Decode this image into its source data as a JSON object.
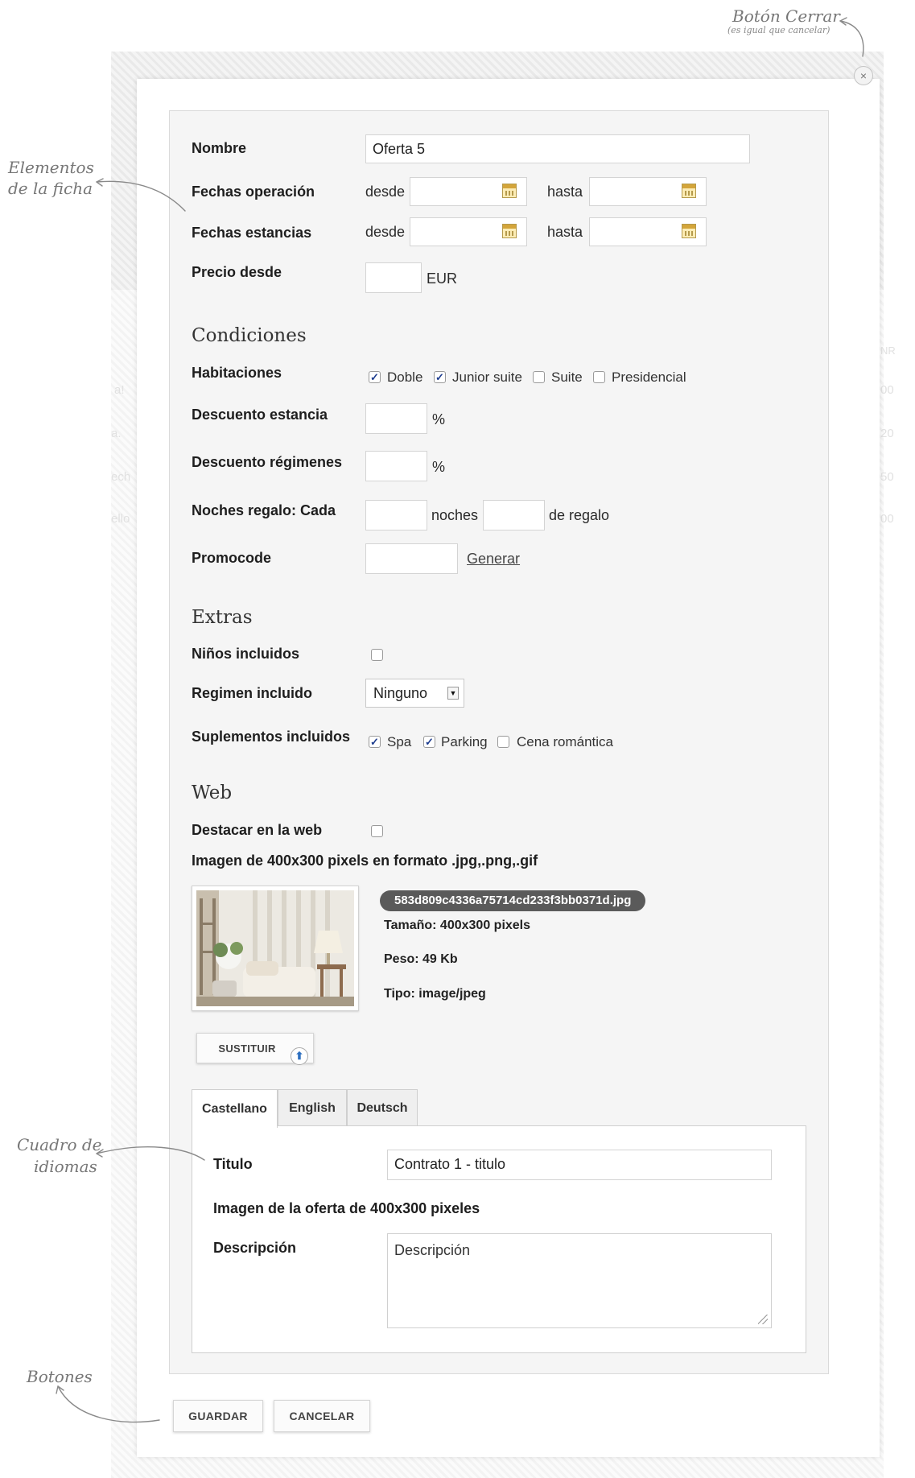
{
  "annotations": {
    "close": {
      "title": "Botón Cerrar",
      "subtitle": "(es igual que cancelar)"
    },
    "elements": {
      "line1": "Elementos",
      "line2": "de la ficha"
    },
    "languages": {
      "line1": "Cuadro de",
      "line2": "idiomas"
    },
    "buttons": "Botones"
  },
  "close_icon": "×",
  "form": {
    "nombre": {
      "label": "Nombre",
      "value": "Oferta 5"
    },
    "fechas_operacion": {
      "label": "Fechas operación",
      "desde": "desde",
      "hasta": "hasta"
    },
    "fechas_estancias": {
      "label": "Fechas estancias",
      "desde": "desde",
      "hasta": "hasta"
    },
    "precio": {
      "label": "Precio desde",
      "unit": "EUR"
    }
  },
  "condiciones": {
    "title": "Condiciones",
    "habitaciones": {
      "label": "Habitaciones",
      "options": [
        {
          "label": "Doble",
          "checked": true
        },
        {
          "label": "Junior suite",
          "checked": true
        },
        {
          "label": "Suite",
          "checked": false
        },
        {
          "label": "Presidencial",
          "checked": false
        }
      ]
    },
    "descuento_estancia": {
      "label": "Descuento estancia",
      "unit": "%"
    },
    "descuento_regimenes": {
      "label": "Descuento régimenes",
      "unit": "%"
    },
    "noches": {
      "label": "Noches regalo: Cada",
      "mid": "noches",
      "end": "de regalo"
    },
    "promocode": {
      "label": "Promocode",
      "link": "Generar"
    }
  },
  "extras": {
    "title": "Extras",
    "ninos": {
      "label": "Niños incluidos",
      "checked": false
    },
    "regimen": {
      "label": "Regimen incluido",
      "selected": "Ninguno"
    },
    "suplementos": {
      "label": "Suplementos incluidos",
      "options": [
        {
          "label": "Spa",
          "checked": true
        },
        {
          "label": "Parking",
          "checked": true
        },
        {
          "label": "Cena romántica",
          "checked": false
        }
      ]
    }
  },
  "web": {
    "title": "Web",
    "destacar": {
      "label": "Destacar en la web",
      "checked": false
    },
    "image_hint": "Imagen de 400x300 pixels en formato .jpg,.png,.gif",
    "file_name": "583d809c4336a75714cd233f3bb0371d.jpg",
    "size": "Tamaño: 400x300 pixels",
    "weight": "Peso: 49 Kb",
    "type": "Tipo: image/jpeg",
    "replace_button": "SUSTITUIR"
  },
  "languages": {
    "tabs": [
      "Castellano",
      "English",
      "Deutsch"
    ],
    "active_tab": "Castellano",
    "titulo": {
      "label": "Titulo",
      "value": "Contrato 1 - titulo"
    },
    "image_label": "Imagen de la oferta de 400x300 pixeles",
    "descripcion": {
      "label": "Descripción",
      "value": "Descripción"
    }
  },
  "buttons": {
    "save": "GUARDAR",
    "cancel": "CANCELAR"
  },
  "background_fragments": {
    "left": [
      "a!",
      "a.",
      "ech",
      "ello"
    ],
    "right": [
      "NR",
      "00",
      "20",
      "50",
      "00"
    ]
  }
}
